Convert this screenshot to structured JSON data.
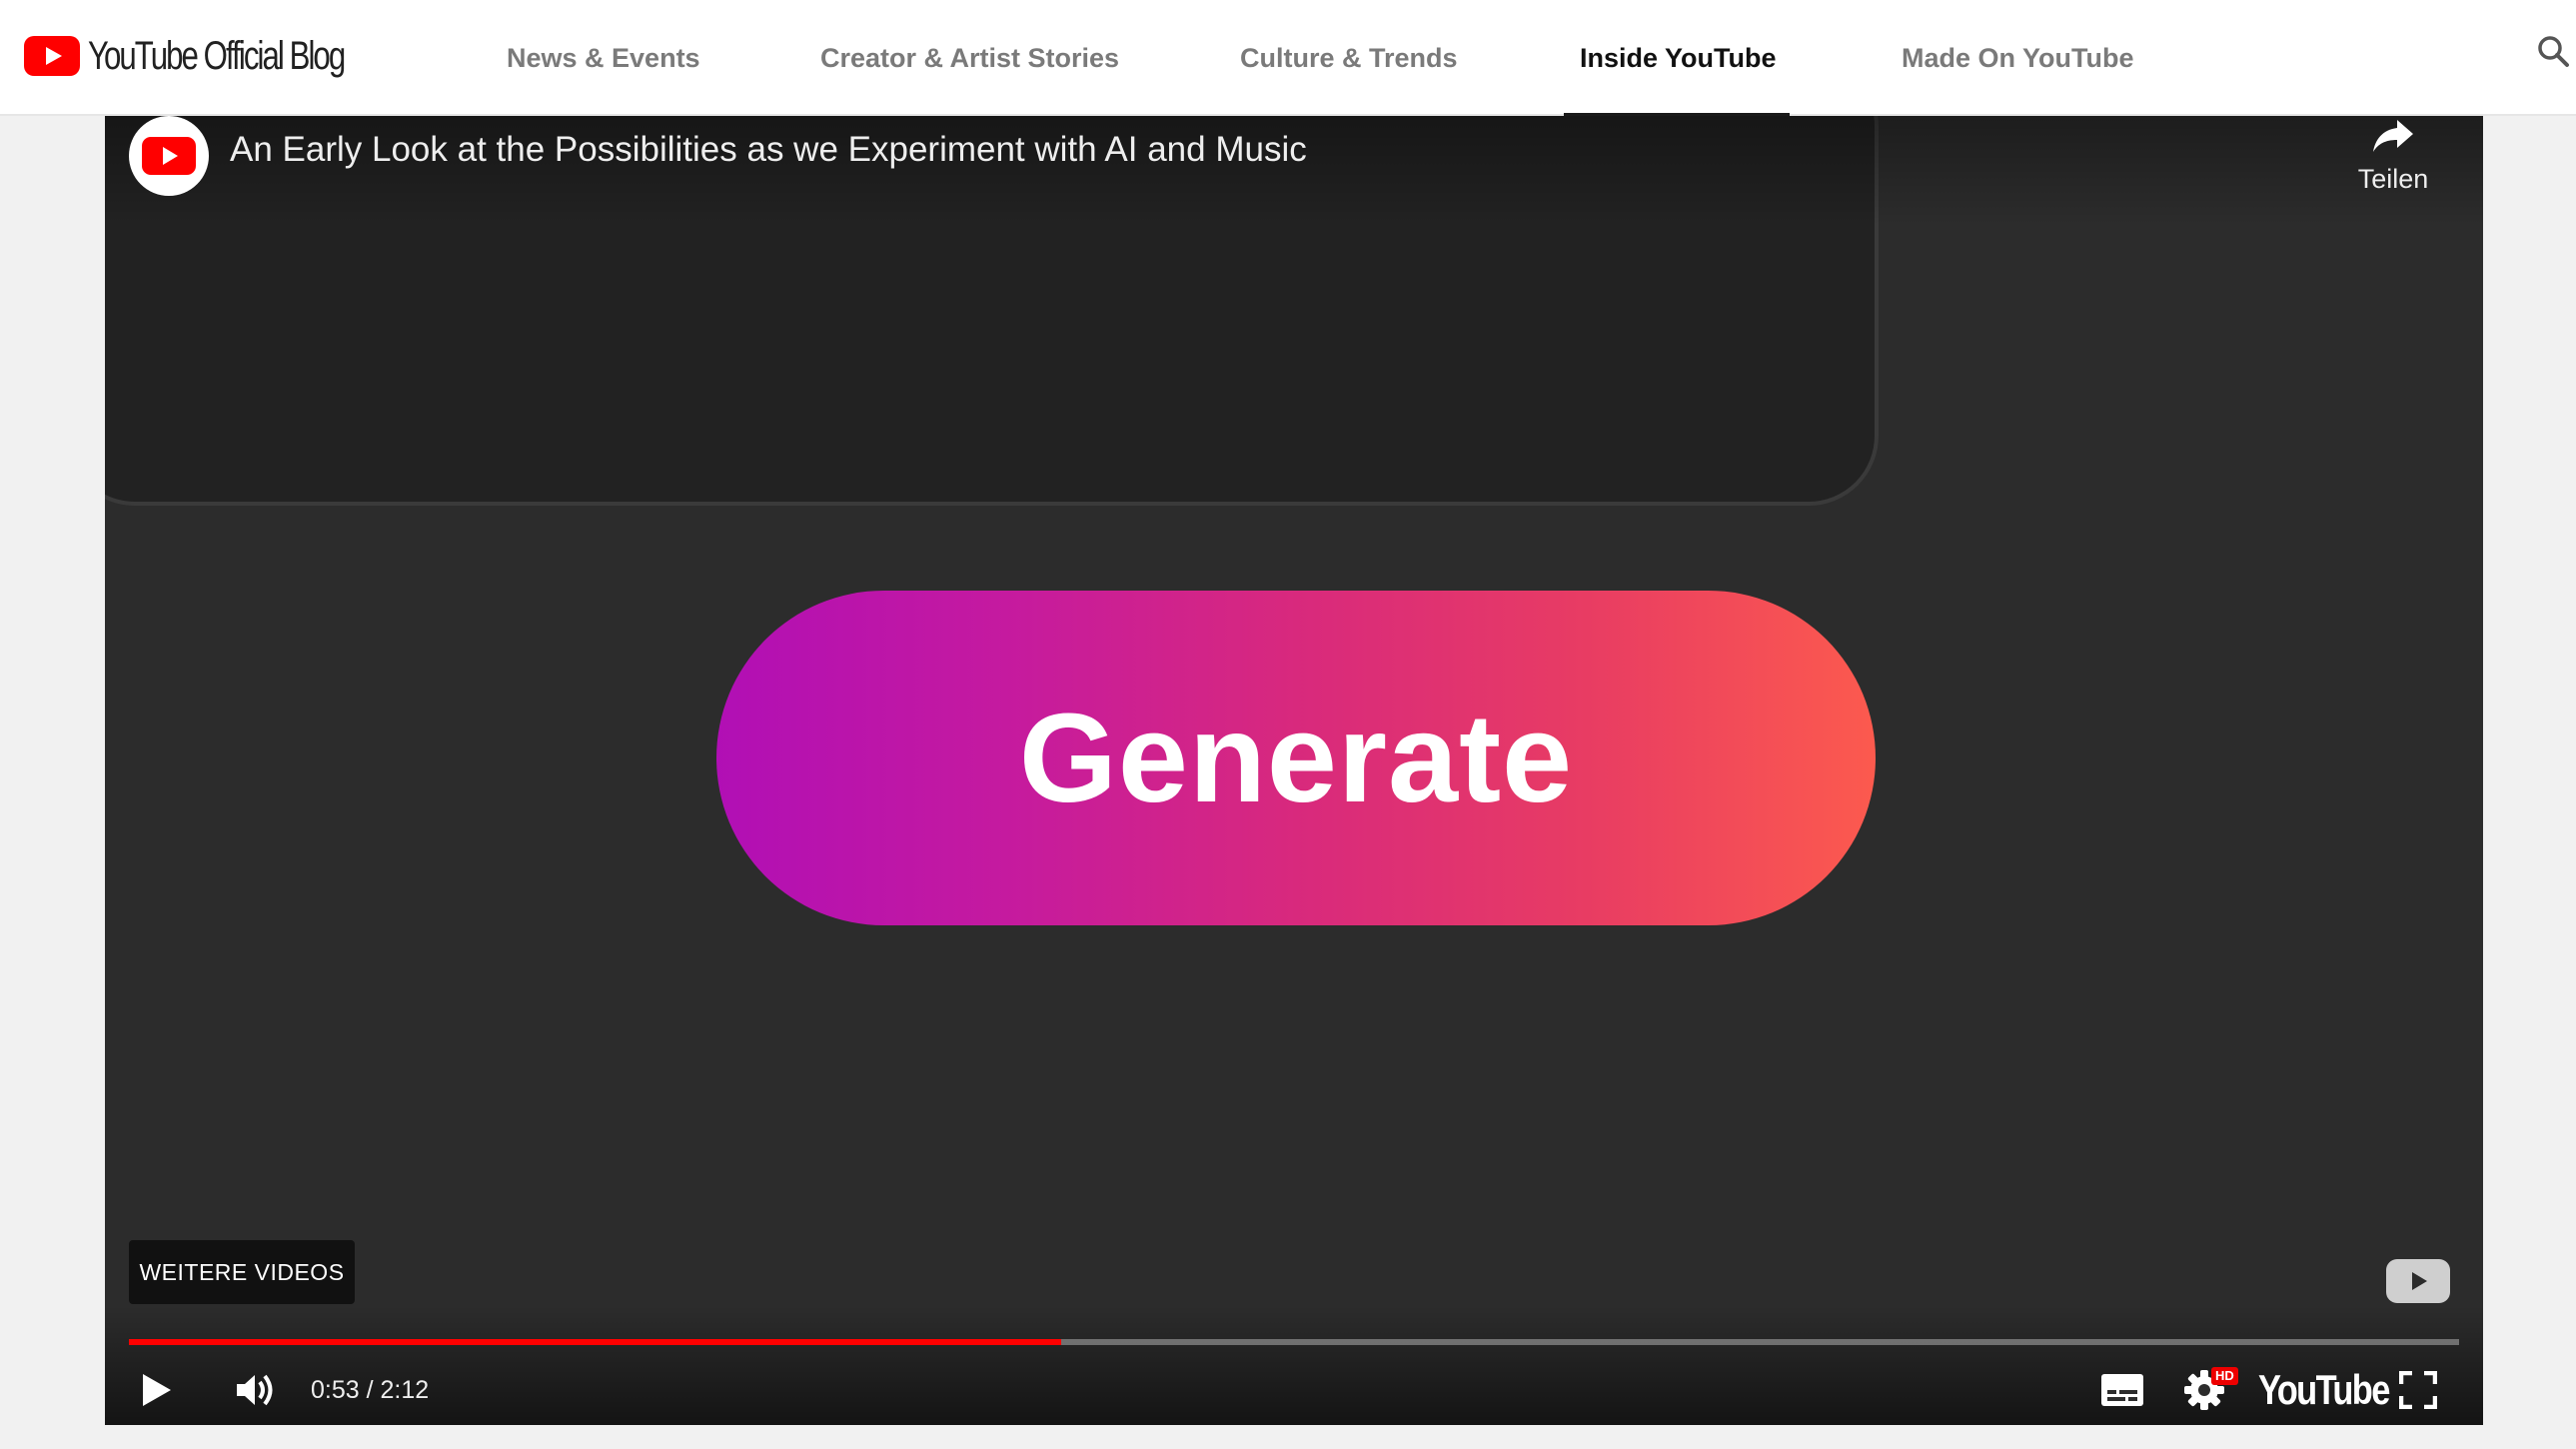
{
  "header": {
    "logo_text": "YouTube Official Blog",
    "nav": [
      {
        "label": "News & Events"
      },
      {
        "label": "Creator & Artist Stories"
      },
      {
        "label": "Culture & Trends"
      },
      {
        "label": "Inside YouTube",
        "active": true
      },
      {
        "label": "Made On YouTube"
      }
    ],
    "search_icon": "search-icon"
  },
  "player": {
    "title": "An Early Look at the Possibilities as we Experiment with AI and Music",
    "share_label": "Teilen",
    "frame_button_text": "Generate",
    "more_videos_label": "WEITERE VIDEOS",
    "current_time": "0:53",
    "time_separator": " / ",
    "duration": "2:12",
    "progress_fraction": 0.4,
    "quality_badge": "HD",
    "brand_wordmark": "YouTube",
    "icons": [
      "play-icon",
      "volume-icon",
      "subtitles-icon",
      "settings-icon",
      "fullscreen-icon",
      "share-icon",
      "youtube-play-icon"
    ]
  },
  "colors": {
    "accent_red": "#ff0000",
    "pill_gradient_start": "#b10fb5",
    "pill_gradient_end": "#fc5a4e",
    "player_bg": "#2c2c2c"
  }
}
